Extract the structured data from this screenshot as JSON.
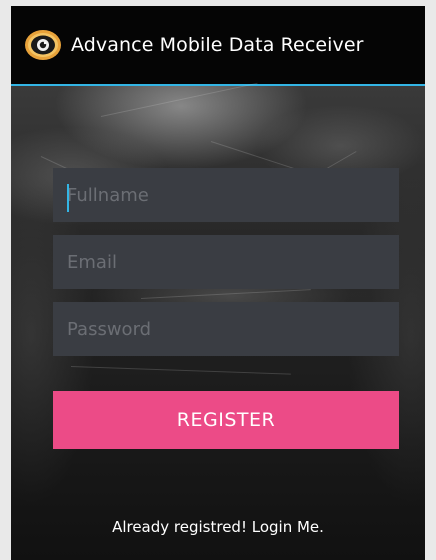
{
  "app_bar": {
    "title": "Advance Mobile Data Receiver",
    "icon": "eye-logo-icon",
    "accent_color": "#33b5e5"
  },
  "form": {
    "fullname": {
      "value": "",
      "placeholder": "Fullname"
    },
    "email": {
      "value": "",
      "placeholder": "Email"
    },
    "password": {
      "value": "",
      "placeholder": "Password"
    },
    "register_label": "REGISTER",
    "register_color": "#ec4b87"
  },
  "footer": {
    "login_link": "Already registred! Login Me."
  }
}
